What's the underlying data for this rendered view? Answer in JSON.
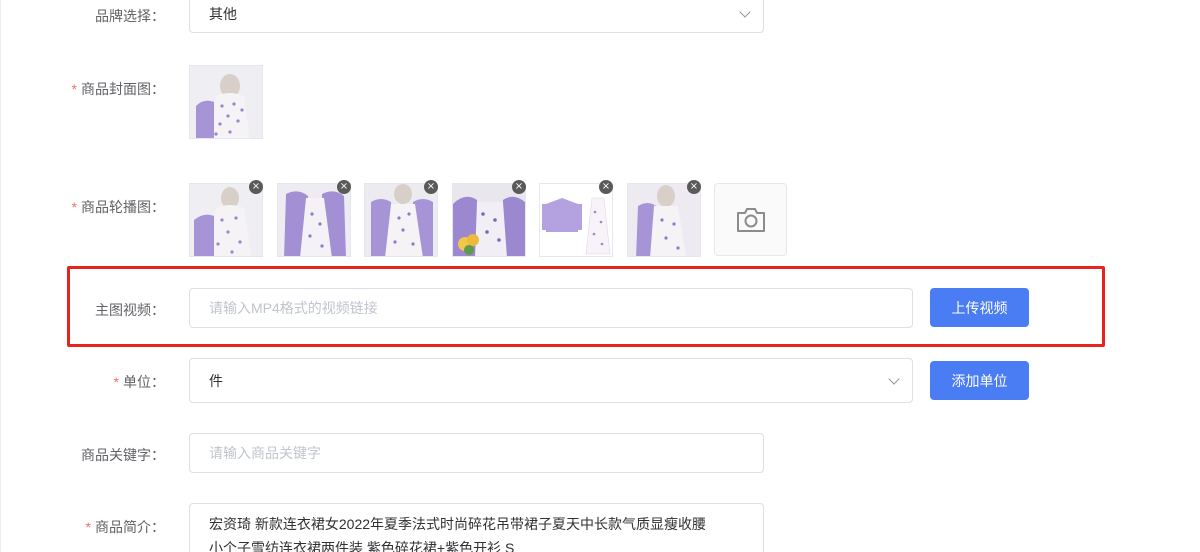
{
  "brand": {
    "label": "品牌选择：",
    "value": "其他"
  },
  "cover": {
    "required_mark": "*",
    "label": "商品封面图："
  },
  "carousel": {
    "required_mark": "*",
    "label": "商品轮播图：",
    "delete_glyph": "×",
    "image_count": 6
  },
  "video": {
    "label": "主图视频：",
    "placeholder": "请输入MP4格式的视频链接",
    "upload_button": "上传视频"
  },
  "unit": {
    "required_mark": "*",
    "label": "单位：",
    "value": "件",
    "add_button": "添加单位"
  },
  "keywords": {
    "label": "商品关键字：",
    "placeholder": "请输入商品关键字"
  },
  "intro": {
    "required_mark": "*",
    "label": "商品简介：",
    "line1": "宏资琦 新款连衣裙女2022年夏季法式时尚碎花吊带裙子夏天中长款气质显瘦收腰",
    "line2": "小个子雪纺连衣裙两件装 紫色碎花裙+紫色开衫 S"
  },
  "colors": {
    "accent": "#4a7cf4",
    "highlight": "#e8231c",
    "required": "#f56c6c",
    "lavender": "#a694d6"
  }
}
